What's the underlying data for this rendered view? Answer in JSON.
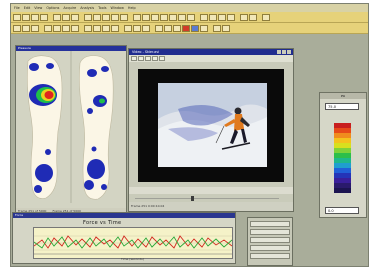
{
  "menubar": [
    "File",
    "Edit",
    "View",
    "Options",
    "Acquire",
    "Analysis",
    "Tools",
    "Window",
    "Help"
  ],
  "pressure_panel": {
    "title": "Pressure",
    "status_left": "Frame 251 of 5000",
    "status_right": "Frame 251 of 5000"
  },
  "video_window": {
    "title": "Video - Skier.avi",
    "status": "Frame 251   0:00:10.04"
  },
  "scale": {
    "title": "PSI",
    "max_value": "75.0",
    "min_value": "0.0",
    "colors": [
      "#c81e1e",
      "#e64a19",
      "#f08c1e",
      "#f4c21e",
      "#d8e01e",
      "#7ed23a",
      "#2dbf4a",
      "#1fb88c",
      "#1f9fcf",
      "#2160d8",
      "#2434b8",
      "#3a1f9a",
      "#2a1a6c",
      "#1c1450"
    ]
  },
  "force_plot": {
    "window_title": "Force",
    "title": "Force vs Time",
    "xlabel": "Time (seconds)"
  },
  "colors": {
    "accent_title": "#25319a",
    "toolbar": "#e6d27a",
    "app_bg": "#a9ad9a"
  }
}
